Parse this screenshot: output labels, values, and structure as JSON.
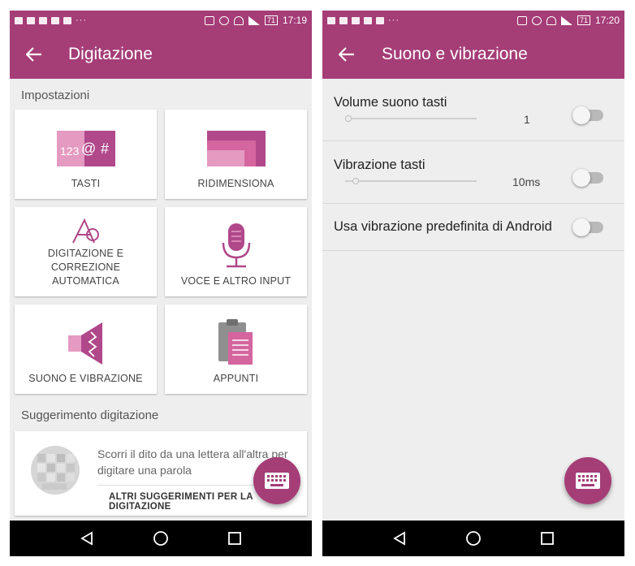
{
  "colors": {
    "accent": "#a53d77",
    "tile_pink": "#d5659f",
    "tile_dark": "#b0488a"
  },
  "left": {
    "status": {
      "time": "17:19",
      "battery": "71"
    },
    "appbar": {
      "title": "Digitazione",
      "back_icon": "arrow-left-icon"
    },
    "section_settings": "Impostazioni",
    "tiles": [
      {
        "label": "TASTI",
        "icon": "keys-icon",
        "icon_text": "123@#"
      },
      {
        "label": "RIDIMENSIONA",
        "icon": "resize-icon"
      },
      {
        "label": "DIGITAZIONE E\nCORREZIONE\nAUTOMATICA",
        "icon": "autocorrect-icon"
      },
      {
        "label": "VOCE E ALTRO INPUT",
        "icon": "microphone-icon"
      },
      {
        "label": "SUONO E VIBRAZIONE",
        "icon": "speaker-icon"
      },
      {
        "label": "APPUNTI",
        "icon": "clipboard-icon"
      }
    ],
    "section_tips": "Suggerimento digitazione",
    "tip": {
      "text": "Scorri il dito da una lettera all'altra per digitare una parola",
      "link": "ALTRI SUGGERIMENTI PER LA DIGITAZIONE"
    },
    "fab_icon": "keyboard-icon"
  },
  "right": {
    "status": {
      "time": "17:20",
      "battery": "71"
    },
    "appbar": {
      "title": "Suono e vibrazione",
      "back_icon": "arrow-left-icon"
    },
    "rows": [
      {
        "label": "Volume suono tasti",
        "value": "1",
        "slider_level": 0.0,
        "enabled": false
      },
      {
        "label": "Vibrazione tasti",
        "value": "10ms",
        "slider_level": 0.06,
        "enabled": false
      },
      {
        "label": "Usa vibrazione predefinita di Android",
        "enabled": false
      }
    ],
    "fab_icon": "keyboard-icon"
  },
  "navbar": {
    "icons": [
      "back-triangle-icon",
      "home-circle-icon",
      "recents-square-icon"
    ]
  }
}
